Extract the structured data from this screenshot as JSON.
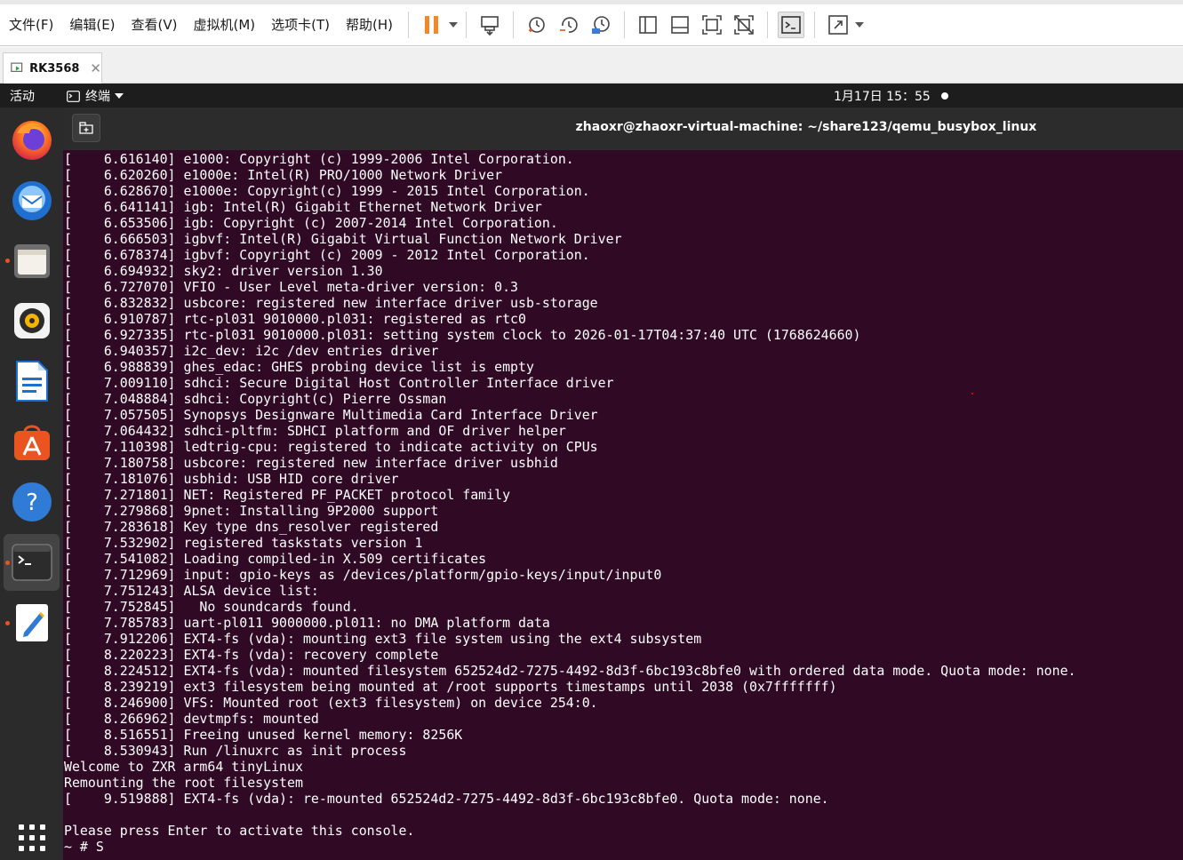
{
  "vmware": {
    "menus": [
      "文件(F)",
      "编辑(E)",
      "查看(V)",
      "虚拟机(M)",
      "选项卡(T)",
      "帮助(H)"
    ],
    "toolbar_icons": [
      "pause-icon",
      "send-keys-icon",
      "snapshot-icon",
      "revert-snapshot-icon",
      "snapshot-manager-icon",
      "library-view-icon",
      "thumbnail-view-icon",
      "fullscreen-icon",
      "unity-icon",
      "console-view-icon",
      "stretch-icon"
    ],
    "tab_label": "RK3568",
    "accent": "#f0892a"
  },
  "ubuntu": {
    "activities": "活动",
    "app_name": "终端",
    "clock": "1月17日  15：55",
    "dock_icons": [
      "firefox-icon",
      "thunderbird-icon",
      "files-icon",
      "rhythmbox-icon",
      "libreoffice-writer-icon",
      "app-center-icon",
      "help-icon",
      "terminal-icon",
      "text-editor-icon",
      "show-apps-icon"
    ]
  },
  "terminal": {
    "title": "zhaoxr@zhaoxr-virtual-machine: ~/share123/qemu_busybox_linux",
    "background": "#300a24",
    "lines": [
      "[    6.616140] e1000: Copyright (c) 1999-2006 Intel Corporation.",
      "[    6.620260] e1000e: Intel(R) PRO/1000 Network Driver",
      "[    6.628670] e1000e: Copyright(c) 1999 - 2015 Intel Corporation.",
      "[    6.641141] igb: Intel(R) Gigabit Ethernet Network Driver",
      "[    6.653506] igb: Copyright (c) 2007-2014 Intel Corporation.",
      "[    6.666503] igbvf: Intel(R) Gigabit Virtual Function Network Driver",
      "[    6.678374] igbvf: Copyright (c) 2009 - 2012 Intel Corporation.",
      "[    6.694932] sky2: driver version 1.30",
      "[    6.727070] VFIO - User Level meta-driver version: 0.3",
      "[    6.832832] usbcore: registered new interface driver usb-storage",
      "[    6.910787] rtc-pl031 9010000.pl031: registered as rtc0",
      "[    6.927335] rtc-pl031 9010000.pl031: setting system clock to 2026-01-17T04:37:40 UTC (1768624660)",
      "[    6.940357] i2c_dev: i2c /dev entries driver",
      "[    6.988839] ghes_edac: GHES probing device list is empty",
      "[    7.009110] sdhci: Secure Digital Host Controller Interface driver",
      "[    7.048884] sdhci: Copyright(c) Pierre Ossman",
      "[    7.057505] Synopsys Designware Multimedia Card Interface Driver",
      "[    7.064432] sdhci-pltfm: SDHCI platform and OF driver helper",
      "[    7.110398] ledtrig-cpu: registered to indicate activity on CPUs",
      "[    7.180758] usbcore: registered new interface driver usbhid",
      "[    7.181076] usbhid: USB HID core driver",
      "[    7.271801] NET: Registered PF_PACKET protocol family",
      "[    7.279868] 9pnet: Installing 9P2000 support",
      "[    7.283618] Key type dns_resolver registered",
      "[    7.532902] registered taskstats version 1",
      "[    7.541082] Loading compiled-in X.509 certificates",
      "[    7.712969] input: gpio-keys as /devices/platform/gpio-keys/input/input0",
      "[    7.751243] ALSA device list:",
      "[    7.752845]   No soundcards found.",
      "[    7.785783] uart-pl011 9000000.pl011: no DMA platform data",
      "[    7.912206] EXT4-fs (vda): mounting ext3 file system using the ext4 subsystem",
      "[    8.220223] EXT4-fs (vda): recovery complete",
      "[    8.224512] EXT4-fs (vda): mounted filesystem 652524d2-7275-4492-8d3f-6bc193c8bfe0 with ordered data mode. Quota mode: none.",
      "[    8.239219] ext3 filesystem being mounted at /root supports timestamps until 2038 (0x7fffffff)",
      "[    8.246900] VFS: Mounted root (ext3 filesystem) on device 254:0.",
      "[    8.266962] devtmpfs: mounted",
      "[    8.516551] Freeing unused kernel memory: 8256K",
      "[    8.530943] Run /linuxrc as init process",
      "Welcome to ZXR arm64 tinyLinux",
      "Remounting the root filesystem",
      "[    9.519888] EXT4-fs (vda): re-mounted 652524d2-7275-4492-8d3f-6bc193c8bfe0. Quota mode: none.",
      "",
      "Please press Enter to activate this console.",
      "~ # S"
    ]
  }
}
